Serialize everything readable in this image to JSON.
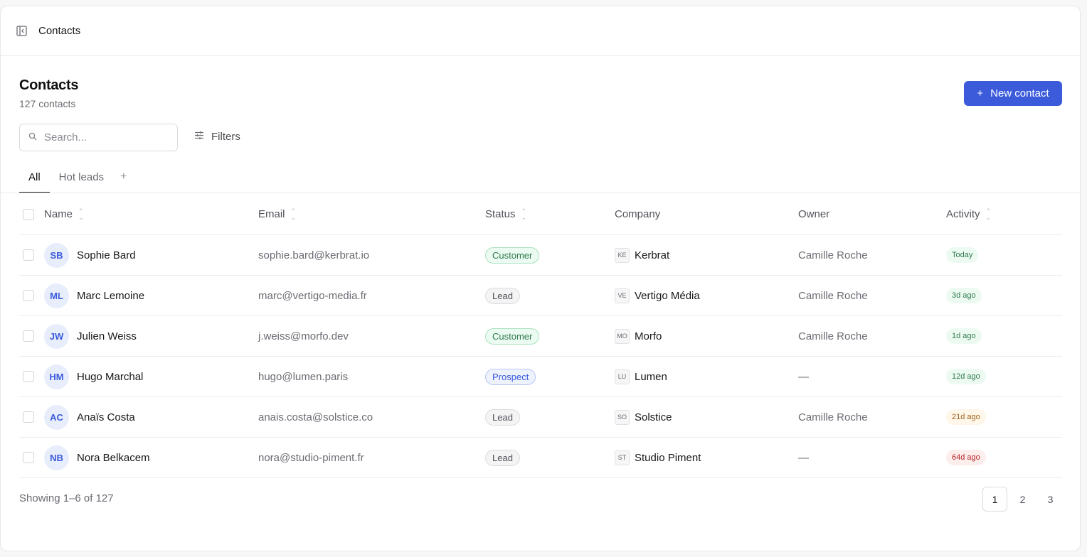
{
  "topbar": {
    "title": "Contacts",
    "toggle_icon": "sidebar-toggle-icon"
  },
  "header": {
    "title": "Contacts",
    "subtitle": "127 contacts",
    "new_button": "New contact"
  },
  "search": {
    "placeholder": "Search...",
    "value": ""
  },
  "filters": {
    "label": "Filters"
  },
  "tabs": [
    {
      "label": "All",
      "active": true
    },
    {
      "label": "Hot leads",
      "active": false
    }
  ],
  "table": {
    "columns": {
      "name": "Name",
      "email": "Email",
      "status": "Status",
      "company": "Company",
      "owner": "Owner",
      "activity": "Activity"
    },
    "rows": [
      {
        "initials": "SB",
        "name": "Sophie Bard",
        "email": "sophie.bard@kerbrat.io",
        "status": "Customer",
        "status_type": "customer",
        "company_code": "KE",
        "company": "Kerbrat",
        "owner": "Camille Roche",
        "activity": "Today",
        "activity_tone": "green"
      },
      {
        "initials": "ML",
        "name": "Marc Lemoine",
        "email": "marc@vertigo-media.fr",
        "status": "Lead",
        "status_type": "lead",
        "company_code": "VE",
        "company": "Vertigo Média",
        "owner": "Camille Roche",
        "activity": "3d ago",
        "activity_tone": "green"
      },
      {
        "initials": "JW",
        "name": "Julien Weiss",
        "email": "j.weiss@morfo.dev",
        "status": "Customer",
        "status_type": "customer",
        "company_code": "MO",
        "company": "Morfo",
        "owner": "Camille Roche",
        "activity": "1d ago",
        "activity_tone": "green"
      },
      {
        "initials": "HM",
        "name": "Hugo Marchal",
        "email": "hugo@lumen.paris",
        "status": "Prospect",
        "status_type": "prospect",
        "company_code": "LU",
        "company": "Lumen",
        "owner": "—",
        "activity": "12d ago",
        "activity_tone": "green"
      },
      {
        "initials": "AC",
        "name": "Anaïs Costa",
        "email": "anais.costa@solstice.co",
        "status": "Lead",
        "status_type": "lead",
        "company_code": "SO",
        "company": "Solstice",
        "owner": "Camille Roche",
        "activity": "21d ago",
        "activity_tone": "amber"
      },
      {
        "initials": "NB",
        "name": "Nora Belkacem",
        "email": "nora@studio-piment.fr",
        "status": "Lead",
        "status_type": "lead",
        "company_code": "ST",
        "company": "Studio Piment",
        "owner": "—",
        "activity": "64d ago",
        "activity_tone": "red"
      }
    ]
  },
  "footer": {
    "showing": "Showing 1–6 of 127"
  },
  "pagination": {
    "pages": [
      "1",
      "2",
      "3"
    ],
    "current": "1"
  },
  "colors": {
    "accent": "#3b5bdb"
  }
}
